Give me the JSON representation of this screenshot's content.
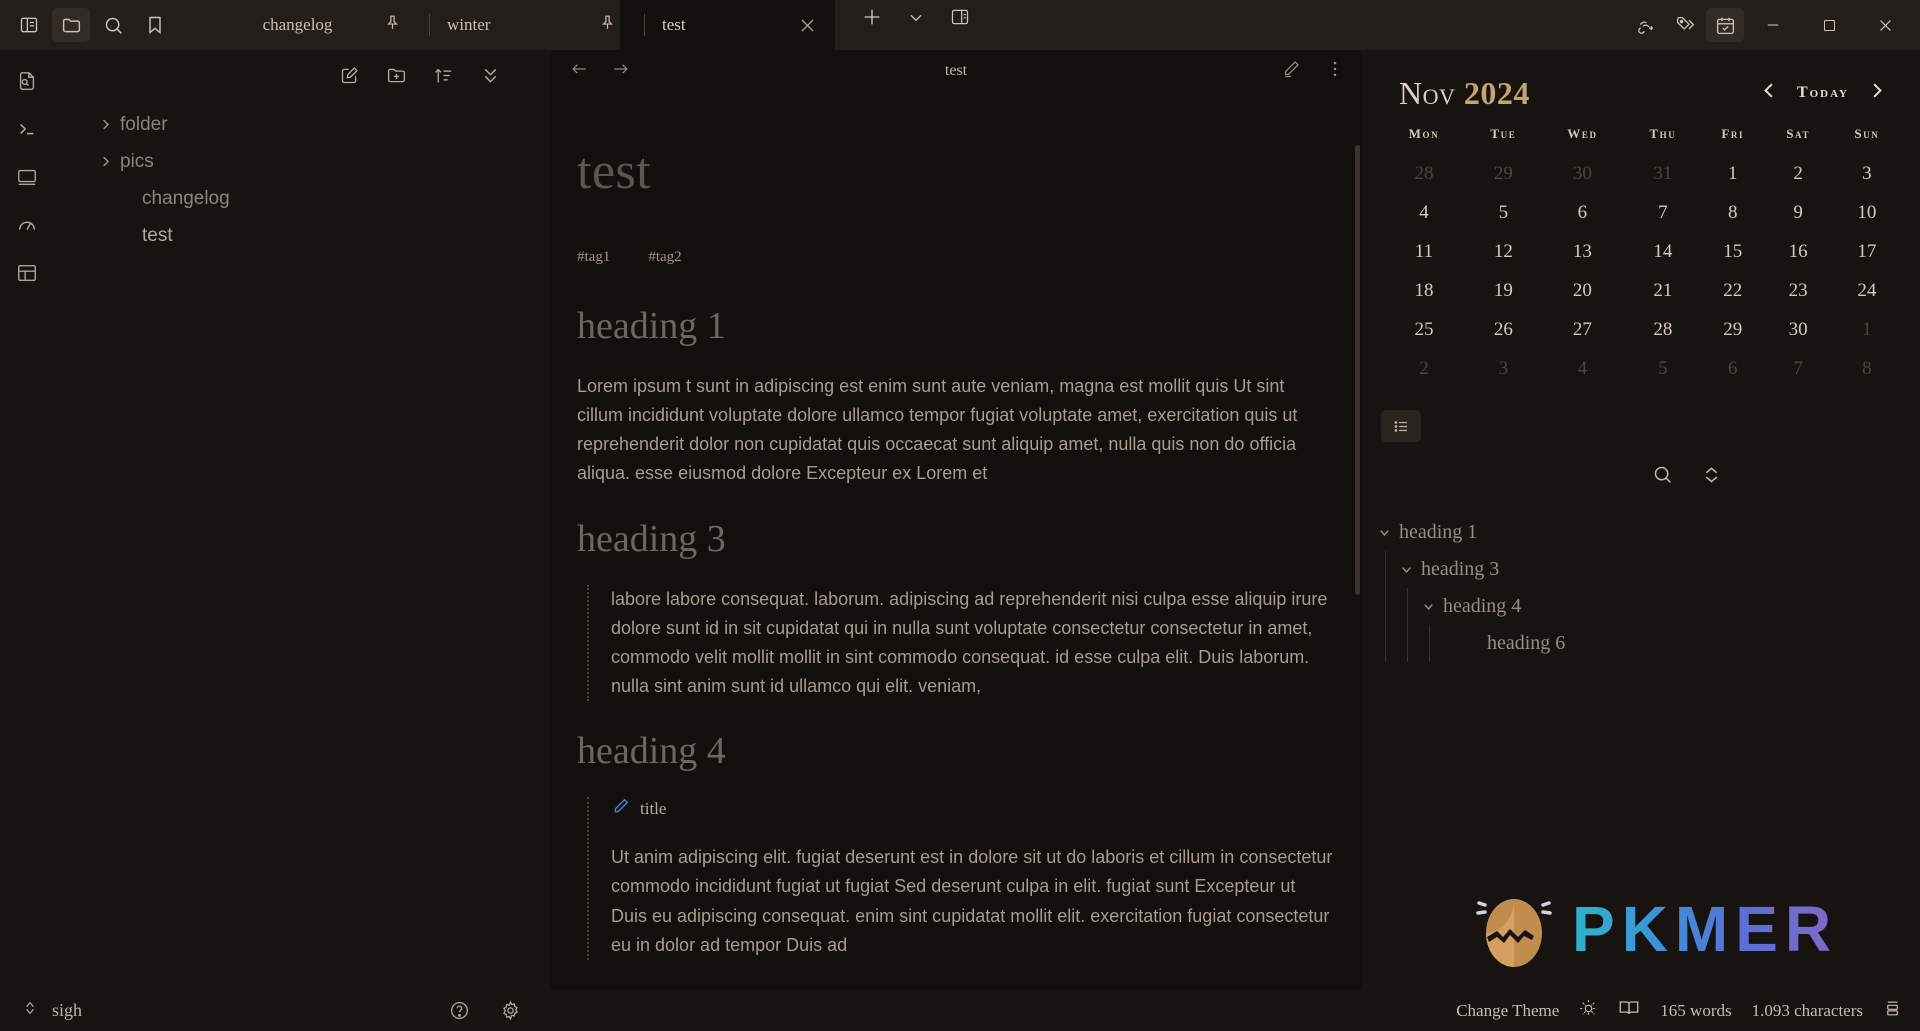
{
  "titlebar": {
    "left_icons": [
      {
        "name": "toggle-left-sidebar-icon",
        "label": "Toggle left sidebar"
      },
      {
        "name": "folder-icon",
        "label": "Files"
      },
      {
        "name": "search-icon",
        "label": "Search"
      },
      {
        "name": "bookmark-icon",
        "label": "Bookmarks"
      }
    ],
    "tabs": [
      {
        "label": "changelog",
        "active": false,
        "pinned": false
      },
      {
        "label": "winter",
        "active": false,
        "pinned": true
      },
      {
        "label": "test",
        "active": true,
        "pinned": true
      }
    ],
    "tab_actions": [
      {
        "name": "close-tab-icon",
        "label": "Close tab"
      },
      {
        "name": "new-tab-icon",
        "label": "New tab"
      },
      {
        "name": "chevron-down-icon",
        "label": "Tab list"
      },
      {
        "name": "split-right-icon",
        "label": "Split right"
      }
    ],
    "right_icons": [
      {
        "name": "link-share-icon",
        "label": "Outgoing links"
      },
      {
        "name": "tag-icon",
        "label": "Tags"
      },
      {
        "name": "calendar-icon",
        "label": "Calendar"
      }
    ],
    "window_controls": [
      {
        "name": "minimize-button",
        "label": "Minimize"
      },
      {
        "name": "maximize-button",
        "label": "Maximize"
      },
      {
        "name": "close-button",
        "label": "Close"
      }
    ]
  },
  "rail": {
    "items": [
      {
        "name": "file-search-icon",
        "label": "Search in file"
      },
      {
        "name": "terminal-icon",
        "label": "Terminal"
      },
      {
        "name": "window-icon",
        "label": "Window"
      },
      {
        "name": "gauge-icon",
        "label": "Dashboard"
      },
      {
        "name": "layout-icon",
        "label": "Layout"
      }
    ]
  },
  "explorer": {
    "toolbar": [
      {
        "name": "new-note-icon",
        "label": "New note"
      },
      {
        "name": "new-folder-icon",
        "label": "New folder"
      },
      {
        "name": "sort-icon",
        "label": "Change sort order"
      },
      {
        "name": "collapse-all-icon",
        "label": "Collapse all"
      }
    ],
    "tree": [
      {
        "label": "folder",
        "type": "folder",
        "expanded": false
      },
      {
        "label": "pics",
        "type": "folder",
        "expanded": false
      },
      {
        "label": "changelog",
        "type": "file",
        "selected": false
      },
      {
        "label": "test",
        "type": "file",
        "selected": true
      }
    ]
  },
  "editor": {
    "header": {
      "title": "test",
      "back_label": "Back",
      "forward_label": "Forward",
      "edit_label": "Edit mode",
      "more_label": "More options"
    },
    "doc_title": "test",
    "tags": [
      "#tag1",
      "#tag2"
    ],
    "blocks": [
      {
        "type": "h1",
        "text": "heading 1"
      },
      {
        "type": "p",
        "text": "Lorem ipsum t sunt in adipiscing est enim sunt aute veniam, magna est mollit quis Ut sint cillum incididunt voluptate dolore ullamco tempor fugiat voluptate amet, exercitation quis ut reprehenderit dolor non cupidatat quis occaecat sunt aliquip amet, nulla quis non do officia aliqua. esse eiusmod dolore Excepteur ex Lorem et"
      },
      {
        "type": "h1",
        "text": "heading 3"
      },
      {
        "type": "quote",
        "text": "labore labore consequat. laborum. adipiscing ad reprehenderit nisi culpa esse aliquip irure dolore sunt id in sit cupidatat qui in nulla sunt voluptate consectetur consectetur in amet, commodo velit mollit mollit in sint commodo consequat. id esse culpa elit. Duis laborum. nulla sint anim sunt id ullamco qui elit. veniam,"
      },
      {
        "type": "h1",
        "text": "heading 4"
      },
      {
        "type": "callout",
        "title": "title",
        "icon": "pencil-icon",
        "text": "Ut anim adipiscing elit. fugiat deserunt est in dolore sit ut do laboris et cillum in consectetur commodo incididunt fugiat ut fugiat Sed deserunt culpa in elit. fugiat sunt Excepteur ut Duis eu adipiscing consequat. enim sint cupidatat mollit elit. exercitation fugiat consectetur eu in dolor ad tempor Duis ad"
      }
    ]
  },
  "calendar": {
    "month": "Nov",
    "year": "2024",
    "today_label": "Today",
    "prev_label": "Previous month",
    "next_label": "Next month",
    "weekdays": [
      "Mon",
      "Tue",
      "Wed",
      "Thu",
      "Fri",
      "Sat",
      "Sun"
    ],
    "weeks": [
      [
        {
          "d": "28",
          "out": true
        },
        {
          "d": "29",
          "out": true
        },
        {
          "d": "30",
          "out": true
        },
        {
          "d": "31",
          "out": true
        },
        {
          "d": "1",
          "out": false
        },
        {
          "d": "2",
          "out": false
        },
        {
          "d": "3",
          "out": false
        }
      ],
      [
        {
          "d": "4",
          "out": false
        },
        {
          "d": "5",
          "out": false
        },
        {
          "d": "6",
          "out": false
        },
        {
          "d": "7",
          "out": false
        },
        {
          "d": "8",
          "out": false
        },
        {
          "d": "9",
          "out": false
        },
        {
          "d": "10",
          "out": false
        }
      ],
      [
        {
          "d": "11",
          "out": false
        },
        {
          "d": "12",
          "out": false
        },
        {
          "d": "13",
          "out": false
        },
        {
          "d": "14",
          "out": false
        },
        {
          "d": "15",
          "out": false
        },
        {
          "d": "16",
          "out": false
        },
        {
          "d": "17",
          "out": false
        }
      ],
      [
        {
          "d": "18",
          "out": false
        },
        {
          "d": "19",
          "out": false
        },
        {
          "d": "20",
          "out": false
        },
        {
          "d": "21",
          "out": false
        },
        {
          "d": "22",
          "out": false
        },
        {
          "d": "23",
          "out": false
        },
        {
          "d": "24",
          "out": false
        }
      ],
      [
        {
          "d": "25",
          "out": false
        },
        {
          "d": "26",
          "out": false
        },
        {
          "d": "27",
          "out": false
        },
        {
          "d": "28",
          "out": false
        },
        {
          "d": "29",
          "out": false
        },
        {
          "d": "30",
          "out": false
        },
        {
          "d": "1",
          "out": true
        }
      ],
      [
        {
          "d": "2",
          "out": true
        },
        {
          "d": "3",
          "out": true
        },
        {
          "d": "4",
          "out": true
        },
        {
          "d": "5",
          "out": true
        },
        {
          "d": "6",
          "out": true
        },
        {
          "d": "7",
          "out": true
        },
        {
          "d": "8",
          "out": true
        }
      ]
    ]
  },
  "outline": {
    "toggle_label": "Outline",
    "search_label": "Search outline",
    "collapse_label": "Collapse all",
    "items": [
      {
        "label": "heading 1",
        "level": 1,
        "expanded": true
      },
      {
        "label": "heading 3",
        "level": 2,
        "expanded": true
      },
      {
        "label": "heading 4",
        "level": 3,
        "expanded": true
      },
      {
        "label": "heading 6",
        "level": 4,
        "expanded": false
      }
    ]
  },
  "logo": {
    "text": "PKMER",
    "mark": "cracked-egg-icon"
  },
  "statusbar": {
    "vault_name": "sigh",
    "help_label": "Help",
    "settings_label": "Settings",
    "change_theme": "Change Theme",
    "theme_icon": "sun-icon",
    "reading_icon": "book-icon",
    "word_count": "165 words",
    "char_count": "1.093 characters",
    "layout_icon": "stack-icon"
  }
}
